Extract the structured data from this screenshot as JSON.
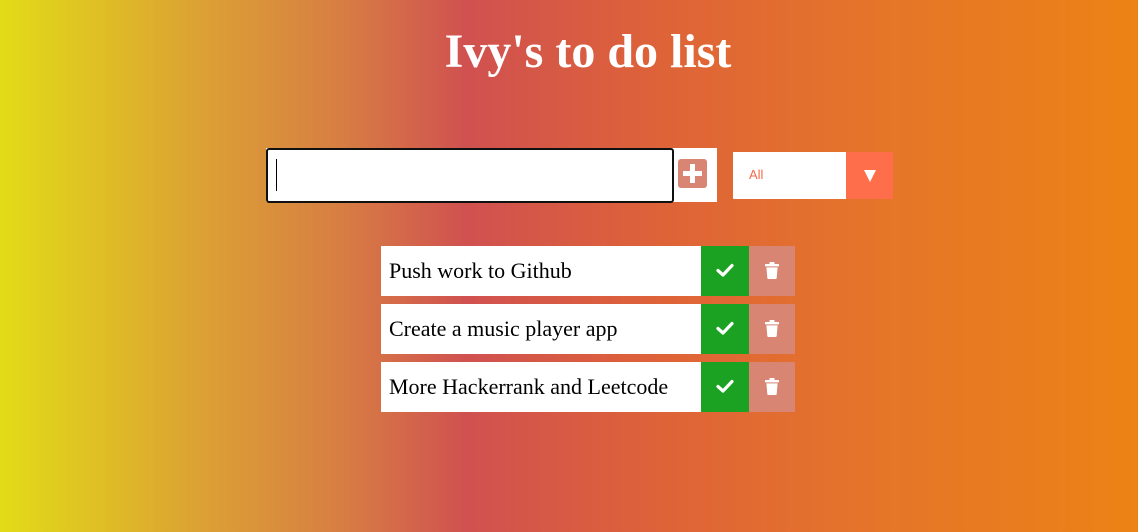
{
  "header": {
    "title": "Ivy's to do list"
  },
  "new_todo": {
    "value": "",
    "placeholder": "",
    "add_icon": "plus-square-icon"
  },
  "filter": {
    "selected": "All",
    "arrow_icon": "caret-down-icon"
  },
  "todos": [
    {
      "text": "Push work to Github"
    },
    {
      "text": "Create a music player app"
    },
    {
      "text": "More Hackerrank and Leetcode"
    }
  ],
  "icons": {
    "complete": "check-icon",
    "delete": "trash-icon"
  },
  "colors": {
    "complete_button": "#1ba222",
    "delete_button": "#d88573",
    "filter_accent": "#ff6e4a",
    "title_text": "#ffffff"
  }
}
